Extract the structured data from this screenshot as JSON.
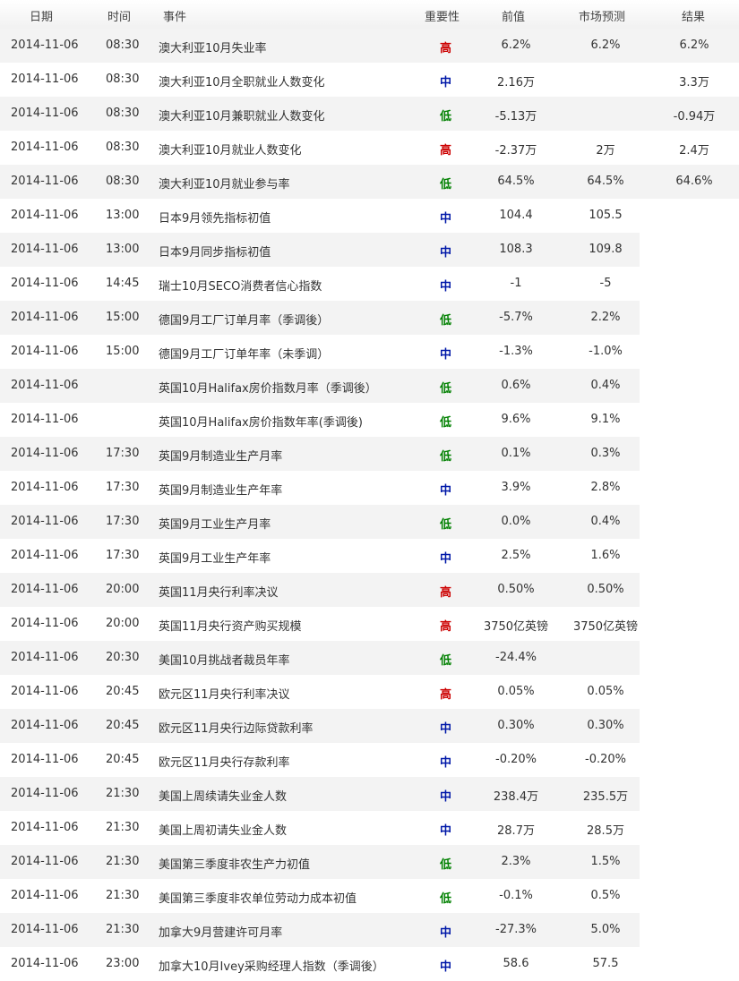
{
  "headers": {
    "date": "日期",
    "time": "时间",
    "event": "事件",
    "importance": "重要性",
    "previous": "前值",
    "forecast": "市场预测",
    "result": "结果"
  },
  "importance_colors": {
    "高": "#cc0000",
    "中": "#0018a8",
    "低": "#008000"
  },
  "rows": [
    {
      "date": "2014-11-06",
      "time": "08:30",
      "event": "澳大利亚10月失业率",
      "importance": "高",
      "previous": "6.2%",
      "forecast": "6.2%",
      "result": "6.2%"
    },
    {
      "date": "2014-11-06",
      "time": "08:30",
      "event": "澳大利亚10月全职就业人数变化",
      "importance": "中",
      "previous": "2.16万",
      "forecast": "",
      "result": "3.3万"
    },
    {
      "date": "2014-11-06",
      "time": "08:30",
      "event": "澳大利亚10月兼职就业人数变化",
      "importance": "低",
      "previous": "-5.13万",
      "forecast": "",
      "result": "-0.94万"
    },
    {
      "date": "2014-11-06",
      "time": "08:30",
      "event": "澳大利亚10月就业人数变化",
      "importance": "高",
      "previous": "-2.37万",
      "forecast": "2万",
      "result": "2.4万"
    },
    {
      "date": "2014-11-06",
      "time": "08:30",
      "event": "澳大利亚10月就业参与率",
      "importance": "低",
      "previous": "64.5%",
      "forecast": "64.5%",
      "result": "64.6%"
    },
    {
      "date": "2014-11-06",
      "time": "13:00",
      "event": "日本9月领先指标初值",
      "importance": "中",
      "previous": "104.4",
      "forecast": "105.5",
      "result": ""
    },
    {
      "date": "2014-11-06",
      "time": "13:00",
      "event": "日本9月同步指标初值",
      "importance": "中",
      "previous": "108.3",
      "forecast": "109.8",
      "result": ""
    },
    {
      "date": "2014-11-06",
      "time": "14:45",
      "event": "瑞士10月SECO消费者信心指数",
      "importance": "中",
      "previous": "-1",
      "forecast": "-5",
      "result": ""
    },
    {
      "date": "2014-11-06",
      "time": "15:00",
      "event": "德国9月工厂订单月率（季调後）",
      "importance": "低",
      "previous": "-5.7%",
      "forecast": "2.2%",
      "result": ""
    },
    {
      "date": "2014-11-06",
      "time": "15:00",
      "event": "德国9月工厂订单年率（未季调）",
      "importance": "中",
      "previous": "-1.3%",
      "forecast": "-1.0%",
      "result": ""
    },
    {
      "date": "2014-11-06",
      "time": "",
      "event": "英国10月Halifax房价指数月率（季调後）",
      "importance": "低",
      "previous": "0.6%",
      "forecast": "0.4%",
      "result": ""
    },
    {
      "date": "2014-11-06",
      "time": "",
      "event": "英国10月Halifax房价指数年率(季调後)",
      "importance": "低",
      "previous": "9.6%",
      "forecast": "9.1%",
      "result": ""
    },
    {
      "date": "2014-11-06",
      "time": "17:30",
      "event": "英国9月制造业生产月率",
      "importance": "低",
      "previous": "0.1%",
      "forecast": "0.3%",
      "result": ""
    },
    {
      "date": "2014-11-06",
      "time": "17:30",
      "event": "英国9月制造业生产年率",
      "importance": "中",
      "previous": "3.9%",
      "forecast": "2.8%",
      "result": ""
    },
    {
      "date": "2014-11-06",
      "time": "17:30",
      "event": "英国9月工业生产月率",
      "importance": "低",
      "previous": "0.0%",
      "forecast": "0.4%",
      "result": ""
    },
    {
      "date": "2014-11-06",
      "time": "17:30",
      "event": "英国9月工业生产年率",
      "importance": "中",
      "previous": "2.5%",
      "forecast": "1.6%",
      "result": ""
    },
    {
      "date": "2014-11-06",
      "time": "20:00",
      "event": "英国11月央行利率决议",
      "importance": "高",
      "previous": "0.50%",
      "forecast": "0.50%",
      "result": ""
    },
    {
      "date": "2014-11-06",
      "time": "20:00",
      "event": "英国11月央行资产购买规模",
      "importance": "高",
      "previous": "3750亿英镑",
      "forecast": "3750亿英镑",
      "result": ""
    },
    {
      "date": "2014-11-06",
      "time": "20:30",
      "event": "美国10月挑战者裁员年率",
      "importance": "低",
      "previous": "-24.4%",
      "forecast": "",
      "result": ""
    },
    {
      "date": "2014-11-06",
      "time": "20:45",
      "event": "欧元区11月央行利率决议",
      "importance": "高",
      "previous": "0.05%",
      "forecast": "0.05%",
      "result": ""
    },
    {
      "date": "2014-11-06",
      "time": "20:45",
      "event": "欧元区11月央行边际贷款利率",
      "importance": "中",
      "previous": "0.30%",
      "forecast": "0.30%",
      "result": ""
    },
    {
      "date": "2014-11-06",
      "time": "20:45",
      "event": "欧元区11月央行存款利率",
      "importance": "中",
      "previous": "-0.20%",
      "forecast": "-0.20%",
      "result": ""
    },
    {
      "date": "2014-11-06",
      "time": "21:30",
      "event": "美国上周续请失业金人数",
      "importance": "中",
      "previous": "238.4万",
      "forecast": "235.5万",
      "result": ""
    },
    {
      "date": "2014-11-06",
      "time": "21:30",
      "event": "美国上周初请失业金人数",
      "importance": "中",
      "previous": "28.7万",
      "forecast": "28.5万",
      "result": ""
    },
    {
      "date": "2014-11-06",
      "time": "21:30",
      "event": "美国第三季度非农生产力初值",
      "importance": "低",
      "previous": "2.3%",
      "forecast": "1.5%",
      "result": ""
    },
    {
      "date": "2014-11-06",
      "time": "21:30",
      "event": "美国第三季度非农单位劳动力成本初值",
      "importance": "低",
      "previous": "-0.1%",
      "forecast": "0.5%",
      "result": ""
    },
    {
      "date": "2014-11-06",
      "time": "21:30",
      "event": "加拿大9月营建许可月率",
      "importance": "中",
      "previous": "-27.3%",
      "forecast": "5.0%",
      "result": ""
    },
    {
      "date": "2014-11-06",
      "time": "23:00",
      "event": "加拿大10月Ivey采购经理人指数（季调後）",
      "importance": "中",
      "previous": "58.6",
      "forecast": "57.5",
      "result": ""
    }
  ]
}
